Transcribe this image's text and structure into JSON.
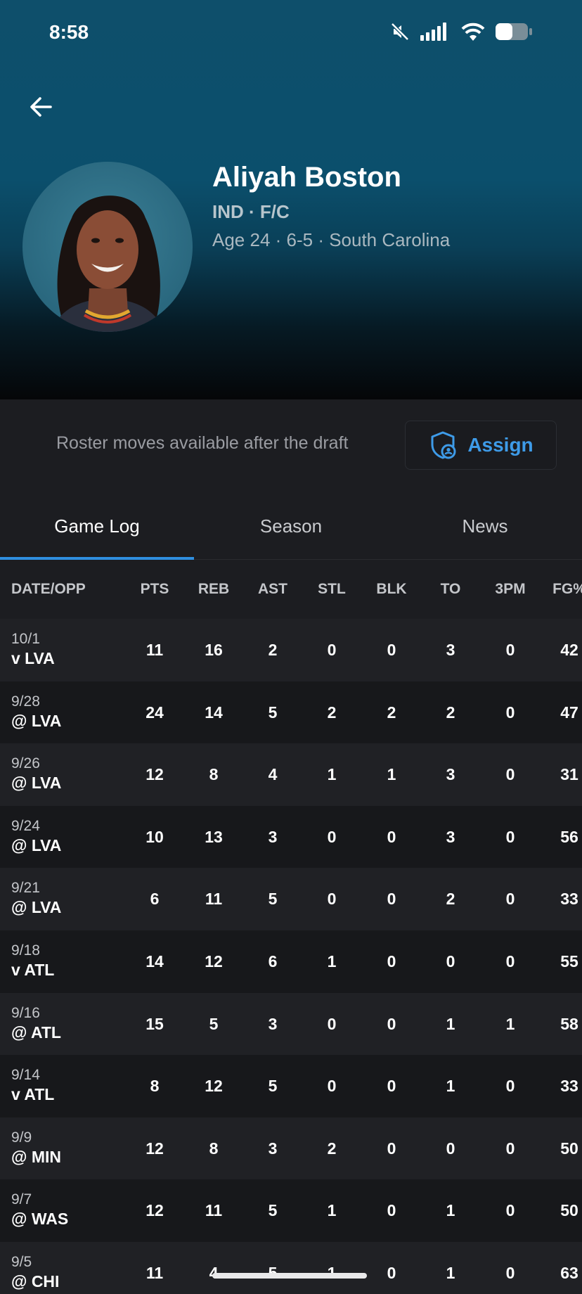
{
  "status_bar": {
    "time": "8:58",
    "icons": [
      "mute-icon",
      "signal-icon",
      "wifi-icon",
      "battery-icon"
    ]
  },
  "header": {
    "back_icon": "arrow-left-icon"
  },
  "player": {
    "name": "Aliyah Boston",
    "team_position": "IND · F/C",
    "bio": "Age 24 · 6-5 · South Carolina"
  },
  "roster": {
    "note": "Roster moves available after the draft",
    "assign_label": "Assign",
    "assign_icon": "shield-user-icon"
  },
  "tabs": [
    {
      "label": "Game Log",
      "active": true
    },
    {
      "label": "Season",
      "active": false
    },
    {
      "label": "News",
      "active": false
    }
  ],
  "accent_color": "#2f8fe0",
  "table": {
    "headers": [
      "DATE/OPP",
      "PTS",
      "REB",
      "AST",
      "STL",
      "BLK",
      "TO",
      "3PM",
      "FG%"
    ],
    "rows": [
      {
        "date": "10/1",
        "opp": "v LVA",
        "stats": [
          "11",
          "16",
          "2",
          "0",
          "0",
          "3",
          "0",
          "42"
        ]
      },
      {
        "date": "9/28",
        "opp": "@ LVA",
        "stats": [
          "24",
          "14",
          "5",
          "2",
          "2",
          "2",
          "0",
          "47"
        ]
      },
      {
        "date": "9/26",
        "opp": "@ LVA",
        "stats": [
          "12",
          "8",
          "4",
          "1",
          "1",
          "3",
          "0",
          "31"
        ]
      },
      {
        "date": "9/24",
        "opp": "@ LVA",
        "stats": [
          "10",
          "13",
          "3",
          "0",
          "0",
          "3",
          "0",
          "56"
        ]
      },
      {
        "date": "9/21",
        "opp": "@ LVA",
        "stats": [
          "6",
          "11",
          "5",
          "0",
          "0",
          "2",
          "0",
          "33"
        ]
      },
      {
        "date": "9/18",
        "opp": "v ATL",
        "stats": [
          "14",
          "12",
          "6",
          "1",
          "0",
          "0",
          "0",
          "55"
        ]
      },
      {
        "date": "9/16",
        "opp": "@ ATL",
        "stats": [
          "15",
          "5",
          "3",
          "0",
          "0",
          "1",
          "1",
          "58"
        ]
      },
      {
        "date": "9/14",
        "opp": "v ATL",
        "stats": [
          "8",
          "12",
          "5",
          "0",
          "0",
          "1",
          "0",
          "33"
        ]
      },
      {
        "date": "9/9",
        "opp": "@ MIN",
        "stats": [
          "12",
          "8",
          "3",
          "2",
          "0",
          "0",
          "0",
          "50"
        ]
      },
      {
        "date": "9/7",
        "opp": "@ WAS",
        "stats": [
          "12",
          "11",
          "5",
          "1",
          "0",
          "1",
          "0",
          "50"
        ]
      },
      {
        "date": "9/5",
        "opp": "@ CHI",
        "stats": [
          "11",
          "4",
          "5",
          "1",
          "0",
          "1",
          "0",
          "63"
        ]
      }
    ]
  }
}
